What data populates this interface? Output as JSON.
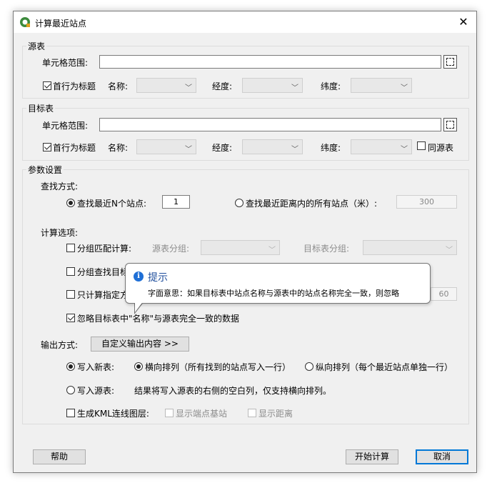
{
  "window": {
    "title": "计算最近站点"
  },
  "source_table": {
    "group_label": "源表",
    "range_label": "单元格范围:",
    "range_value": "",
    "header_row_label": "首行为标题",
    "header_row_checked": true,
    "name_label": "名称:",
    "lon_label": "经度:",
    "lat_label": "纬度:"
  },
  "target_table": {
    "group_label": "目标表",
    "range_label": "单元格范围:",
    "range_value": "",
    "header_row_label": "首行为标题",
    "header_row_checked": true,
    "name_label": "名称:",
    "lon_label": "经度:",
    "lat_label": "纬度:",
    "same_as_source_label": "同源表",
    "same_as_source_checked": false
  },
  "params": {
    "group_label": "参数设置",
    "search_mode_label": "查找方式:",
    "find_n_label": "查找最近N个站点:",
    "find_n_value": "1",
    "find_radius_label": "查找最近距离内的所有站点（米）:",
    "find_radius_value": "300",
    "calc_options_label": "计算选项:",
    "group_match_label": "分组匹配计算:",
    "source_group_label": "源表分组:",
    "target_group_label": "目标表分组:",
    "group_find_label": "分组查找目标",
    "only_calc_label": "只计算指定方",
    "only_calc_value": "60",
    "ignore_same_name_label": "忽略目标表中\"名称\"与源表完全一致的数据",
    "ignore_same_name_checked": true,
    "output_mode_label": "输出方式:",
    "custom_output_button": "自定义输出内容 >>",
    "write_new_label": "写入新表:",
    "horizontal_label": "横向排列（所有找到的站点写入一行）",
    "vertical_label": "纵向排列（每个最近站点单独一行）",
    "write_source_label": "写入源表:",
    "write_source_note": "结果将写入源表的右侧的空白列，仅支持横向排列。",
    "kml_label": "生成KML连线图层:",
    "show_endpoint_label": "显示端点基站",
    "show_distance_label": "显示距离"
  },
  "tooltip": {
    "title": "提示",
    "text": "字面意思：如果目标表中站点名称与源表中的站点名称完全一致，则忽略"
  },
  "footer": {
    "help_button": "帮助",
    "start_button": "开始计算",
    "cancel_button": "取消"
  },
  "colors": {
    "accent": "#0078d7",
    "tooltip_title": "#1f4e9c"
  }
}
